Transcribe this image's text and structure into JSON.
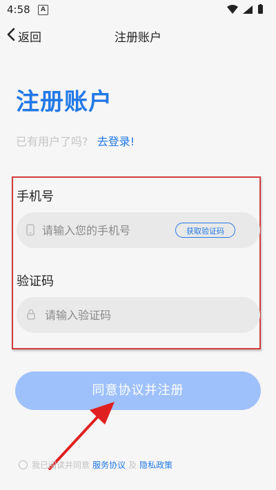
{
  "status_bar": {
    "time": "4:58",
    "notification_letter": "A"
  },
  "nav": {
    "back_label": "返回",
    "title": "注册账户"
  },
  "heading": "注册账户",
  "login_prompt": {
    "hint": "已有用户了吗?",
    "link": "去登录!"
  },
  "phone": {
    "label": "手机号",
    "placeholder": "请输入您的手机号",
    "value": "",
    "code_button": "获取验证码"
  },
  "code": {
    "label": "验证码",
    "placeholder": "请输入验证码",
    "value": ""
  },
  "submit_label": "同意协议并注册",
  "agreement": {
    "prefix": "我已阅读并同意",
    "service_link": "服务协议",
    "and": "及",
    "privacy_link": "隐私政策",
    "checked": false
  },
  "colors": {
    "accent": "#2279e6",
    "button_disabled": "#9fc1fb",
    "annotation": "#d23a3a"
  }
}
